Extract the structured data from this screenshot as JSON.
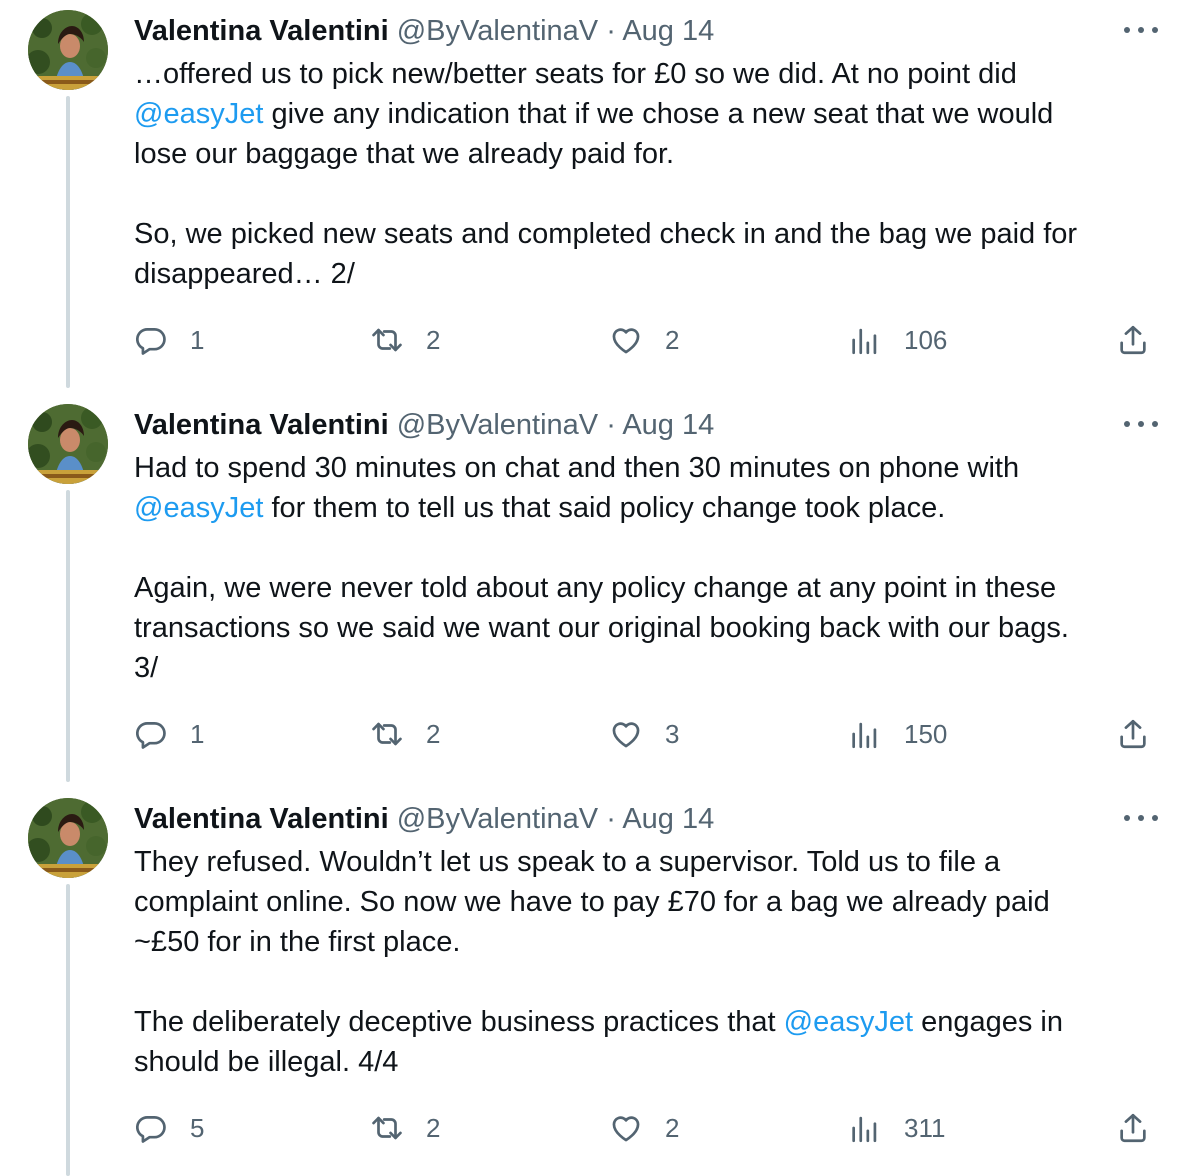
{
  "tweets": [
    {
      "author": {
        "name": "Valentina Valentini",
        "handle": "@ByValentinaV",
        "separator": "·",
        "date": "Aug 14"
      },
      "lines": [
        [
          {
            "t": "…offered us to pick new/better seats for £0 so we did. At no point did"
          }
        ],
        [
          {
            "t": "@easyJet",
            "mention": true
          },
          {
            "t": " give any indication that if we chose a new seat that we would"
          }
        ],
        [
          {
            "t": "lose our baggage that we already paid for."
          }
        ],
        [],
        [
          {
            "t": "So, we picked new seats and completed check in and the bag we paid for"
          }
        ],
        [
          {
            "t": "disappeared… 2/"
          }
        ]
      ],
      "stats": {
        "replies": "1",
        "retweets": "2",
        "likes": "2",
        "views": "106"
      }
    },
    {
      "author": {
        "name": "Valentina Valentini",
        "handle": "@ByValentinaV",
        "separator": "·",
        "date": "Aug 14"
      },
      "lines": [
        [
          {
            "t": "Had to spend 30 minutes on chat and then 30 minutes on phone with"
          }
        ],
        [
          {
            "t": "@easyJet",
            "mention": true
          },
          {
            "t": " for them to tell us that said policy change took place."
          }
        ],
        [],
        [
          {
            "t": "Again, we were never told about any policy change at any point in these"
          }
        ],
        [
          {
            "t": "transactions so we said we want our original booking back with our bags."
          }
        ],
        [
          {
            "t": "3/"
          }
        ]
      ],
      "stats": {
        "replies": "1",
        "retweets": "2",
        "likes": "3",
        "views": "150"
      }
    },
    {
      "author": {
        "name": "Valentina Valentini",
        "handle": "@ByValentinaV",
        "separator": "·",
        "date": "Aug 14"
      },
      "lines": [
        [
          {
            "t": "They refused. Wouldn’t let us speak to a supervisor. Told us to file a"
          }
        ],
        [
          {
            "t": "complaint online. So now we have to pay £70 for a bag we already paid"
          }
        ],
        [
          {
            "t": "~£50 for in the first place."
          }
        ],
        [],
        [
          {
            "t": "The deliberately deceptive business practices that "
          },
          {
            "t": "@easyJet",
            "mention": true
          },
          {
            "t": " engages in"
          }
        ],
        [
          {
            "t": "should be illegal. 4/4"
          }
        ]
      ],
      "stats": {
        "replies": "5",
        "retweets": "2",
        "likes": "2",
        "views": "311"
      }
    }
  ],
  "icons": {
    "reply": "reply-icon",
    "retweet": "retweet-icon",
    "like": "heart-icon",
    "views": "views-icon",
    "share": "share-icon",
    "more": "more-icon"
  },
  "colors": {
    "text": "#0f1419",
    "secondary": "#536471",
    "mention": "#1d9bf0",
    "thread_line": "#cfd9de"
  }
}
